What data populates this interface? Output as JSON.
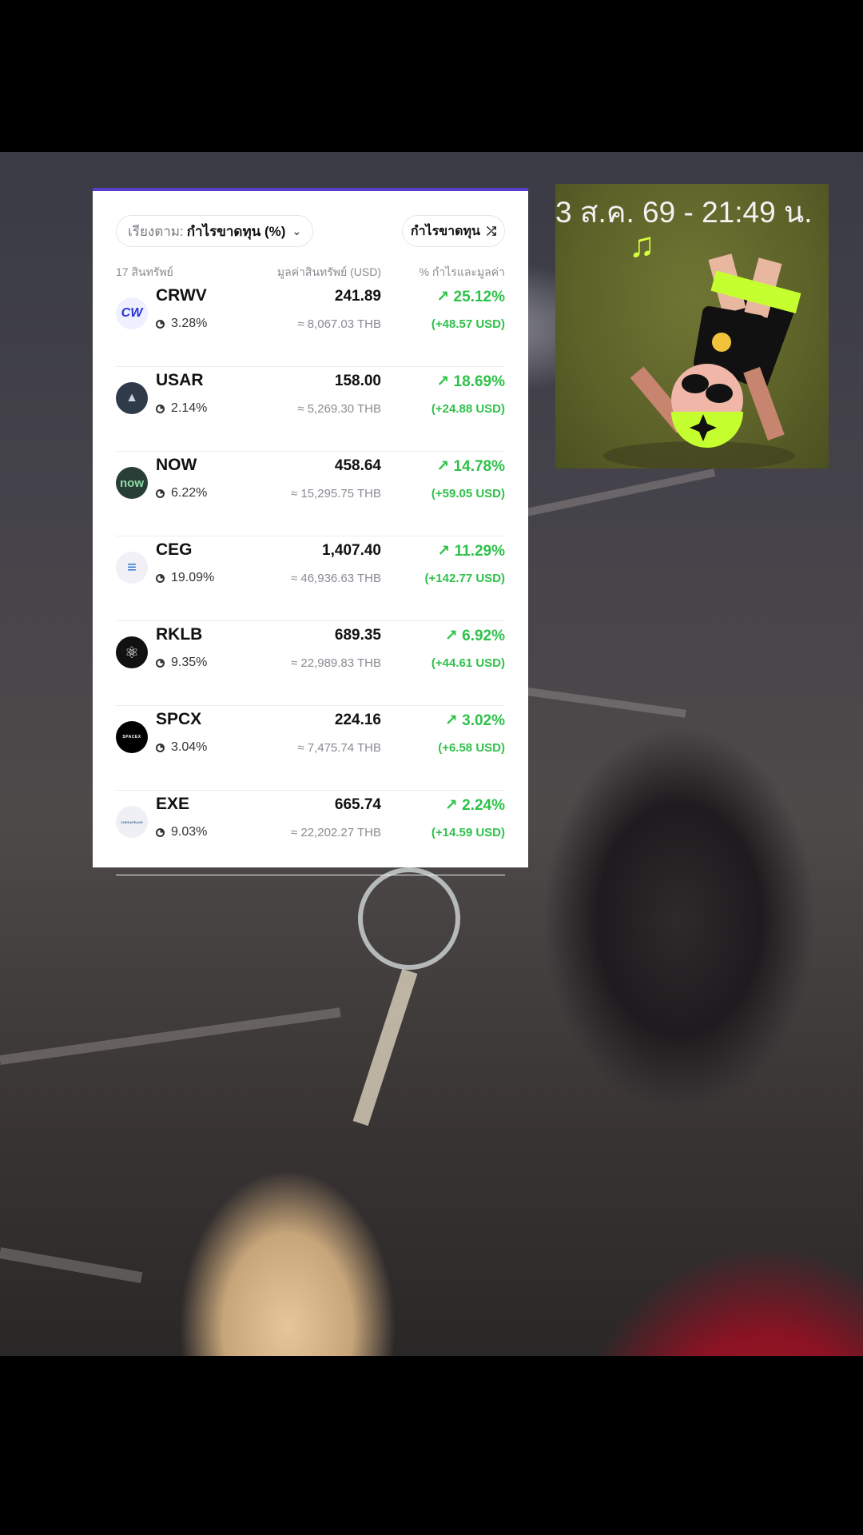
{
  "sort": {
    "prefix": "เรียงตาม:",
    "value": "กำไรขาดทุน (%)"
  },
  "toggle": {
    "label": "กำไรขาดทุน"
  },
  "headers": {
    "count": "17 สินทรัพย์",
    "value": "มูลค่าสินทรัพย์ (USD)",
    "pct": "% กำไรและมูลค่า"
  },
  "assets": [
    {
      "symbol": "CRWV",
      "allocation": "3.28%",
      "value_usd": "241.89",
      "value_thb": "≈ 8,067.03 THB",
      "pct": "↗ 25.12%",
      "gain": "(+48.57 USD)",
      "logo_text": "CW"
    },
    {
      "symbol": "USAR",
      "allocation": "2.14%",
      "value_usd": "158.00",
      "value_thb": "≈ 5,269.30 THB",
      "pct": "↗ 18.69%",
      "gain": "(+24.88 USD)",
      "logo_text": "▲"
    },
    {
      "symbol": "NOW",
      "allocation": "6.22%",
      "value_usd": "458.64",
      "value_thb": "≈ 15,295.75 THB",
      "pct": "↗ 14.78%",
      "gain": "(+59.05 USD)",
      "logo_text": "now"
    },
    {
      "symbol": "CEG",
      "allocation": "19.09%",
      "value_usd": "1,407.40",
      "value_thb": "≈ 46,936.63 THB",
      "pct": "↗ 11.29%",
      "gain": "(+142.77 USD)",
      "logo_text": "≡"
    },
    {
      "symbol": "RKLB",
      "allocation": "9.35%",
      "value_usd": "689.35",
      "value_thb": "≈ 22,989.83 THB",
      "pct": "↗ 6.92%",
      "gain": "(+44.61 USD)",
      "logo_text": "⚛"
    },
    {
      "symbol": "SPCX",
      "allocation": "3.04%",
      "value_usd": "224.16",
      "value_thb": "≈ 7,475.74 THB",
      "pct": "↗ 3.02%",
      "gain": "(+6.58 USD)",
      "logo_text": "SPACEX"
    },
    {
      "symbol": "EXE",
      "allocation": "9.03%",
      "value_usd": "665.74",
      "value_thb": "≈ 22,202.27 THB",
      "pct": "↗ 2.24%",
      "gain": "(+14.59 USD)",
      "logo_text": "CHESAPEAKE"
    }
  ],
  "sticker": {
    "timestamp": "3 ส.ค. 69 - 21:49 น.",
    "note": "♫"
  },
  "colors": {
    "gain_green": "#2ec24a",
    "accent_purple": "#5b3ec8"
  }
}
